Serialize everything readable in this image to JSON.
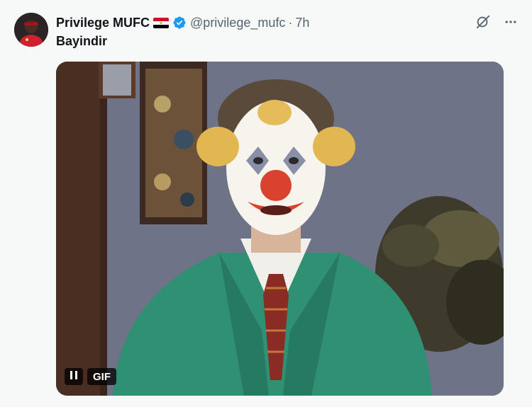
{
  "tweet": {
    "display_name": "Privilege MUFC",
    "handle": "@privilege_mufc",
    "separator": "·",
    "time": "7h",
    "text": "Bayindir",
    "flag_icon": "egypt-flag-icon",
    "verified_icon": "verified-badge-icon"
  },
  "media": {
    "gif_label": "GIF",
    "pause_icon": "pause-icon"
  },
  "actions": {
    "grok_icon": "grok-icon",
    "more_icon": "more-icon"
  },
  "colors": {
    "background": "#f7f9f9",
    "text_primary": "#0f1419",
    "text_secondary": "#536471",
    "verified_blue": "#1d9bf0"
  }
}
